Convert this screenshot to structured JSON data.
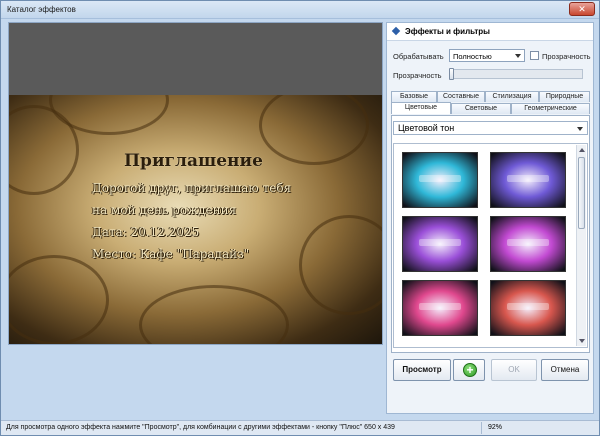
{
  "window": {
    "title": "Каталог эффектов",
    "close_label": "✕"
  },
  "preview": {
    "card_title": "Приглашение",
    "lines": [
      "Дорогой друг, приглашаю тебя",
      "на мой день рождения",
      "Дата: 20.12.2025",
      "Место: Кафе \"Парадайз\""
    ]
  },
  "panel": {
    "title": "Эффекты и фильтры",
    "process_label": "Обрабатывать",
    "process_value": "Полностью",
    "transparency_check_label": "Прозрачность",
    "transparency_check_checked": false,
    "transparency_label": "Прозрачность",
    "transparency_value_fraction": 0.0,
    "tabs_row1": [
      "Базовые",
      "Составные",
      "Стилизация",
      "Природные"
    ],
    "tabs_row2": [
      "Цветовые",
      "Световые",
      "Геометрические"
    ],
    "active_tab": "Цветовые",
    "effect_select": "Цветовой тон",
    "thumbnails": [
      {
        "name": "cyan-tone",
        "color": "#2fb8d8"
      },
      {
        "name": "violet-tone",
        "color": "#6f5ad6"
      },
      {
        "name": "purple-tone",
        "color": "#9a4fd8"
      },
      {
        "name": "magenta-tone",
        "color": "#c24ad2"
      },
      {
        "name": "pink-tone",
        "color": "#e0488e"
      },
      {
        "name": "red-tone",
        "color": "#d8574e"
      }
    ]
  },
  "buttons": {
    "preview": "Просмотр",
    "add": "+",
    "ok": "OK",
    "cancel": "Отмена"
  },
  "status": {
    "text": "Для просмотра одного эффекта нажмите \"Просмотр\", для комбинации с другими эффектами - кнопку \"Плюс\"  650 x 439",
    "zoom": "92%"
  }
}
